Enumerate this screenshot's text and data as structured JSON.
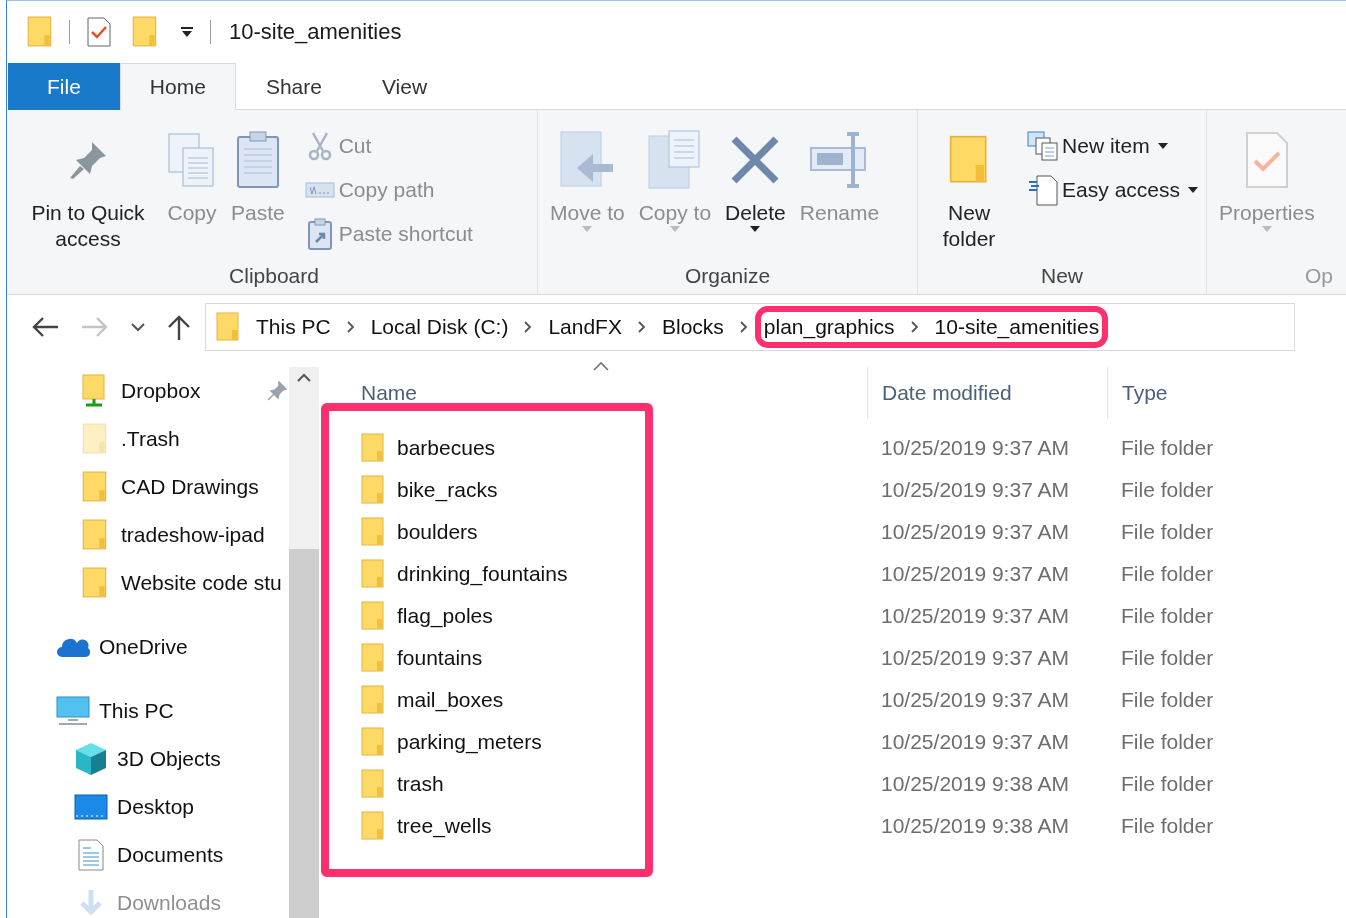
{
  "window": {
    "title": "10-site_amenities"
  },
  "tabs": [
    {
      "label": "File",
      "kind": "file",
      "selected": false
    },
    {
      "label": "Home",
      "kind": "tab",
      "selected": true
    },
    {
      "label": "Share",
      "kind": "tab",
      "selected": false
    },
    {
      "label": "View",
      "kind": "tab",
      "selected": false
    }
  ],
  "ribbon": {
    "groups": [
      {
        "label": "Clipboard",
        "commands": [
          {
            "label": "Pin to Quick access",
            "kind": "pin",
            "disabled": false,
            "dropdown": false
          },
          {
            "label": "Copy",
            "kind": "copy",
            "disabled": true,
            "dropdown": false
          },
          {
            "label": "Paste",
            "kind": "paste",
            "disabled": true,
            "dropdown": false
          },
          {
            "label": "Cut",
            "kind": "cut",
            "disabled": true,
            "dropdown": false
          },
          {
            "label": "Copy path",
            "kind": "copy-path",
            "disabled": true,
            "dropdown": false
          },
          {
            "label": "Paste shortcut",
            "kind": "paste-shortcut",
            "disabled": true,
            "dropdown": false
          }
        ]
      },
      {
        "label": "Organize",
        "commands": [
          {
            "label": "Move to",
            "kind": "move",
            "disabled": true,
            "dropdown": true
          },
          {
            "label": "Copy to",
            "kind": "copy-to",
            "disabled": true,
            "dropdown": true
          },
          {
            "label": "Delete",
            "kind": "delete",
            "disabled": false,
            "dropdown": true
          },
          {
            "label": "Rename",
            "kind": "rename",
            "disabled": true,
            "dropdown": false
          }
        ]
      },
      {
        "label": "New",
        "commands": [
          {
            "label": "New folder",
            "kind": "new-folder",
            "disabled": false,
            "dropdown": false
          },
          {
            "label": "New item",
            "kind": "new-item",
            "disabled": false,
            "dropdown": true
          },
          {
            "label": "Easy access",
            "kind": "easy-access",
            "disabled": false,
            "dropdown": true
          }
        ]
      },
      {
        "label": "Op",
        "commands": [
          {
            "label": "Properties",
            "kind": "properties",
            "disabled": true,
            "dropdown": true
          }
        ]
      }
    ]
  },
  "address": {
    "path": [
      "This PC",
      "Local Disk (C:)",
      "LandFX",
      "Blocks",
      "plan_graphics",
      "10-site_amenities"
    ]
  },
  "sidebar": {
    "items": [
      {
        "label": "Dropbox",
        "kind": "dropbox",
        "pinned": true
      },
      {
        "label": ".Trash",
        "kind": "hidden-folder",
        "pinned": false
      },
      {
        "label": "CAD Drawings",
        "kind": "folder",
        "pinned": false
      },
      {
        "label": "tradeshow-ipad",
        "kind": "folder",
        "pinned": false
      },
      {
        "label": "Website code stu",
        "kind": "folder",
        "pinned": false
      },
      {
        "label": "OneDrive",
        "kind": "onedrive",
        "pinned": false
      },
      {
        "label": "This PC",
        "kind": "pc",
        "pinned": false,
        "children": [
          {
            "label": "3D Objects",
            "kind": "cube",
            "pinned": false
          },
          {
            "label": "Desktop",
            "kind": "desktop",
            "pinned": false
          },
          {
            "label": "Documents",
            "kind": "documents",
            "pinned": false
          },
          {
            "label": "Downloads",
            "kind": "downloads",
            "pinned": false
          }
        ]
      }
    ]
  },
  "table": {
    "columns": [
      {
        "label": "Name",
        "sorted": true
      },
      {
        "label": "Date modified",
        "sorted": false
      },
      {
        "label": "Type",
        "sorted": false
      }
    ],
    "rows": [
      [
        "barbecues",
        "10/25/2019 9:37 AM",
        "File folder"
      ],
      [
        "bike_racks",
        "10/25/2019 9:37 AM",
        "File folder"
      ],
      [
        "boulders",
        "10/25/2019 9:37 AM",
        "File folder"
      ],
      [
        "drinking_fountains",
        "10/25/2019 9:37 AM",
        "File folder"
      ],
      [
        "flag_poles",
        "10/25/2019 9:37 AM",
        "File folder"
      ],
      [
        "fountains",
        "10/25/2019 9:37 AM",
        "File folder"
      ],
      [
        "mail_boxes",
        "10/25/2019 9:37 AM",
        "File folder"
      ],
      [
        "parking_meters",
        "10/25/2019 9:37 AM",
        "File folder"
      ],
      [
        "trash",
        "10/25/2019 9:38 AM",
        "File folder"
      ],
      [
        "tree_wells",
        "10/25/2019 9:38 AM",
        "File folder"
      ]
    ]
  }
}
